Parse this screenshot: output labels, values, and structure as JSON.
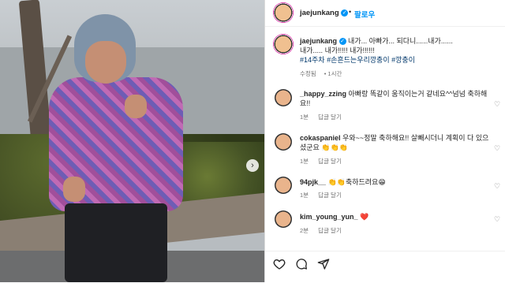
{
  "post": {
    "username": "jaejunkang",
    "follow_label": "팔로우",
    "caption_line1": "내가... 아빠가... 되다니......내가......",
    "caption_line2": "내가..... 내가!!!!! 내가!!!!!!",
    "hashtags": "#14주차 #손흔드는우리깡충이 #깡충이",
    "edited_label": "수정됨",
    "time": "1시간"
  },
  "comments": [
    {
      "username": "_happy_zzing",
      "text": "아빠랑 똑같이 움직이는거 같네요^^넘넘 축하해",
      "text2": "요!!",
      "time": "1분",
      "reply": "답글 달기"
    },
    {
      "username": "cokaspaniel",
      "text": "우와~~정말 축하해요!! 살빼시더니 계획이 다 있으",
      "text2": "셨군요 👏👏👏",
      "time": "1분",
      "reply": "답글 달기"
    },
    {
      "username": "94pjk__",
      "text": "👏👏축하드려요😁",
      "time": "1분",
      "reply": "답글 달기"
    },
    {
      "username": "kim_young_yun_",
      "text": "❤️",
      "time": "2분",
      "reply": "답글 달기"
    }
  ],
  "icons": {
    "verified": "verified-badge-icon",
    "like": "heart-icon",
    "comment": "comment-icon",
    "share": "share-icon",
    "next": "chevron-right-icon"
  },
  "colors": {
    "accent": "#0095f6",
    "hashtag": "#00376b"
  }
}
